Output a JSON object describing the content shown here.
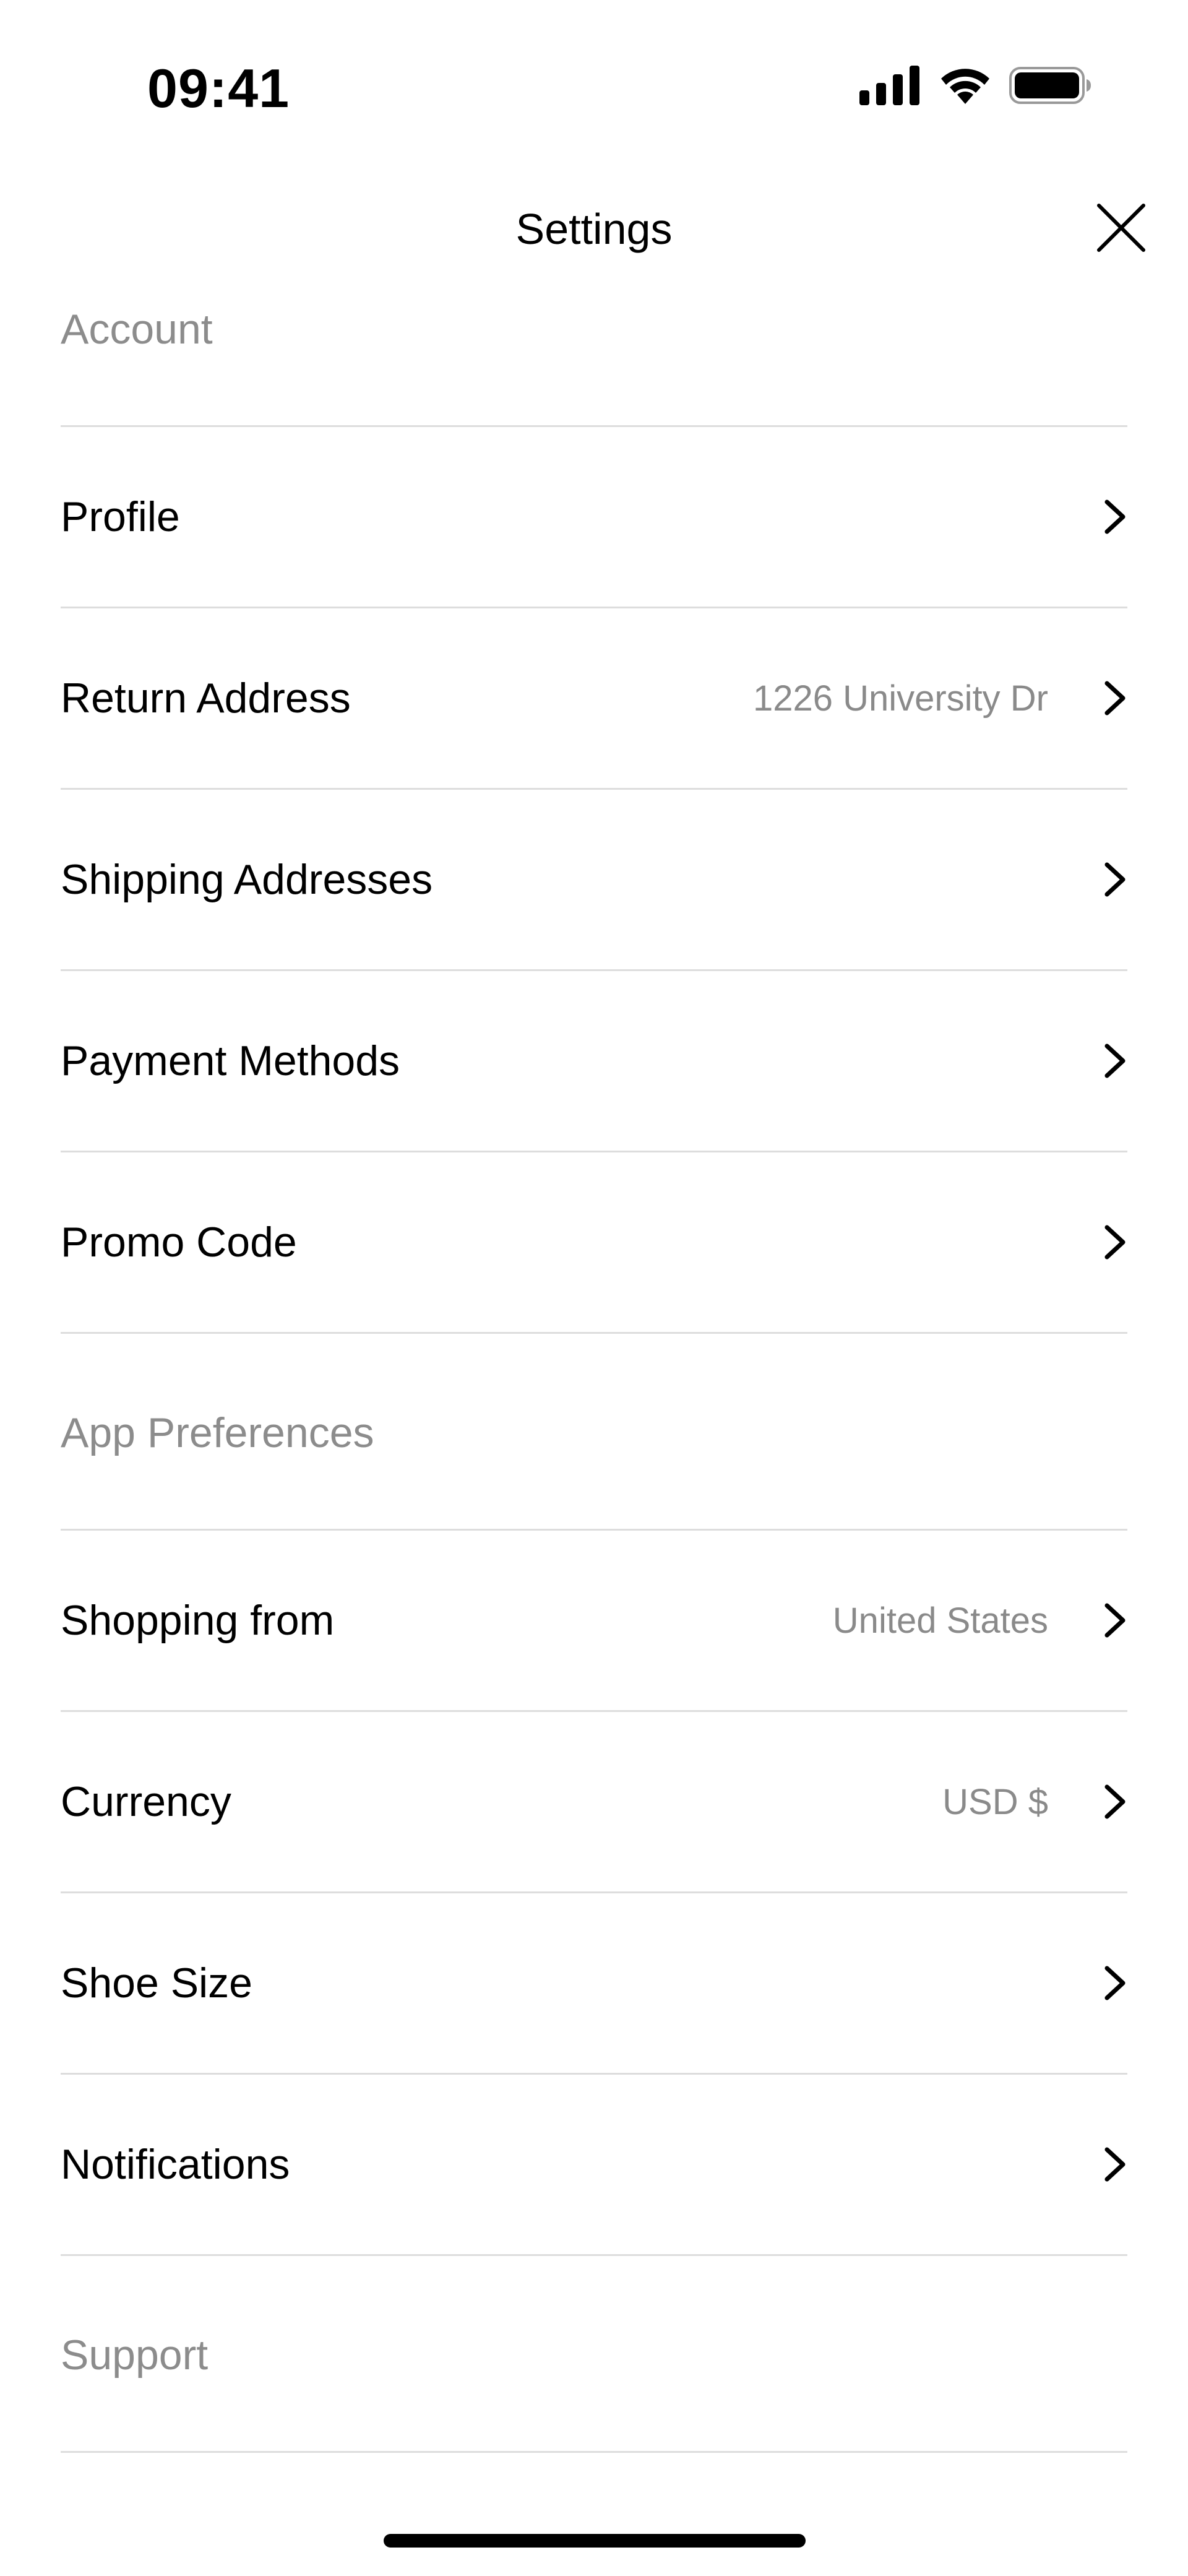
{
  "status_bar": {
    "time": "09:41",
    "icons": [
      "cellular-signal-icon",
      "wifi-icon",
      "battery-icon"
    ]
  },
  "nav": {
    "title": "Settings",
    "close_icon": "close-icon"
  },
  "sections": {
    "account": {
      "title": "Account",
      "items": [
        {
          "label": "Profile",
          "value": ""
        },
        {
          "label": "Return Address",
          "value": "1226 University Dr"
        },
        {
          "label": "Shipping Addresses",
          "value": ""
        },
        {
          "label": "Payment Methods",
          "value": ""
        },
        {
          "label": "Promo Code",
          "value": ""
        }
      ]
    },
    "app_preferences": {
      "title": "App Preferences",
      "items": [
        {
          "label": "Shopping from",
          "value": "United States"
        },
        {
          "label": "Currency",
          "value": "USD $"
        },
        {
          "label": "Shoe Size",
          "value": ""
        },
        {
          "label": "Notifications",
          "value": ""
        }
      ]
    },
    "support": {
      "title": "Support"
    }
  },
  "colors": {
    "section_header": "#8c8c8c",
    "value_text": "#8a8a8a",
    "divider": "#dddddd"
  }
}
